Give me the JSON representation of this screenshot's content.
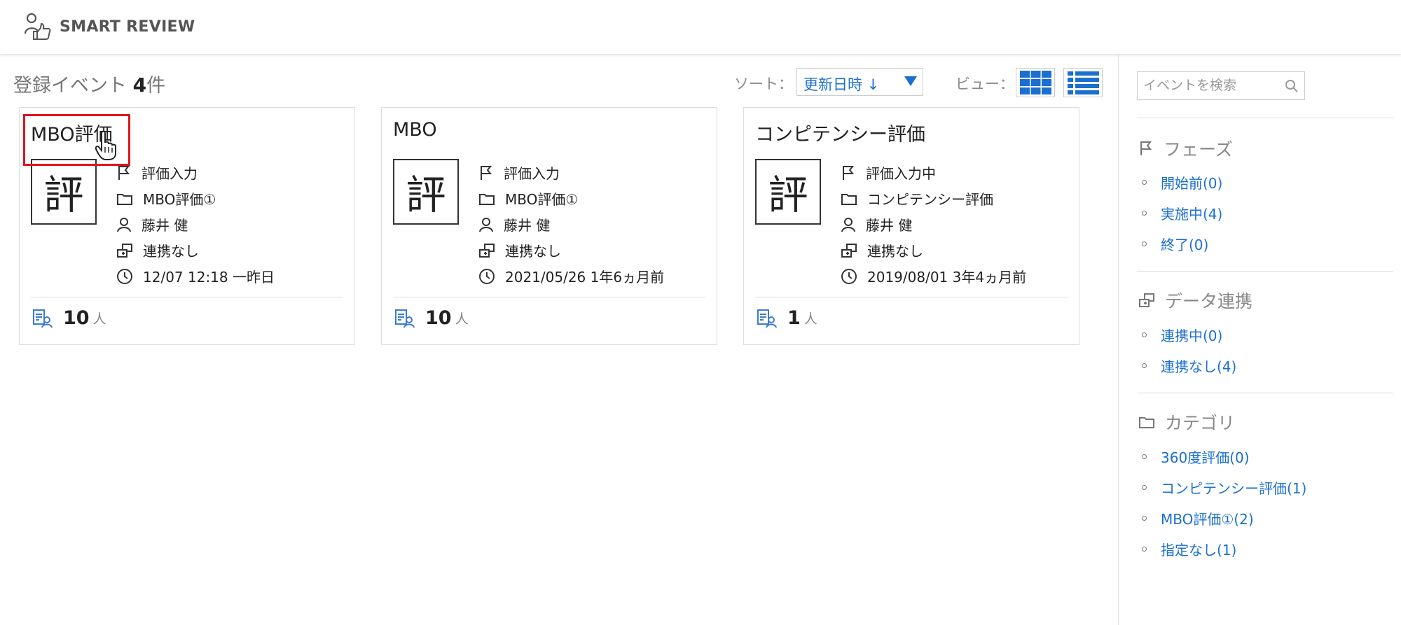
{
  "header": {
    "app_name": "SMART REVIEW"
  },
  "toolbar": {
    "count_prefix": "登録イベント ",
    "count": "4",
    "count_suffix": "件",
    "sort_label": "ソート：",
    "sort_value": "更新日時 ↓",
    "view_label": "ビュー："
  },
  "cards": [
    {
      "title": "MBO評価",
      "thumb": "評",
      "phase": "評価入力",
      "category": "MBO評価①",
      "owner": "藤井 健",
      "link": "連携なし",
      "updated": "12/07 12:18 一昨日",
      "count": "10",
      "unit": "人"
    },
    {
      "title": "MBO",
      "thumb": "評",
      "phase": "評価入力",
      "category": "MBO評価①",
      "owner": "藤井 健",
      "link": "連携なし",
      "updated": "2021/05/26 1年6ヵ月前",
      "count": "10",
      "unit": "人"
    },
    {
      "title": "コンピテンシー評価",
      "thumb": "評",
      "phase": "評価入力中",
      "category": "コンピテンシー評価",
      "owner": "藤井 健",
      "link": "連携なし",
      "updated": "2019/08/01 3年4ヵ月前",
      "count": "1",
      "unit": "人"
    }
  ],
  "sidebar": {
    "search_placeholder": "イベントを検索",
    "phase": {
      "heading": "フェーズ",
      "items": [
        "開始前(0)",
        "実施中(4)",
        "終了(0)"
      ]
    },
    "data_link": {
      "heading": "データ連携",
      "items": [
        "連携中(0)",
        "連携なし(4)"
      ]
    },
    "category": {
      "heading": "カテゴリ",
      "items": [
        "360度評価(0)",
        "コンピテンシー評価(1)",
        "MBO評価①(2)",
        "指定なし(1)"
      ]
    }
  },
  "colors": {
    "link": "#1a6fd0",
    "highlight": "#e0141e",
    "muted": "#888888"
  }
}
